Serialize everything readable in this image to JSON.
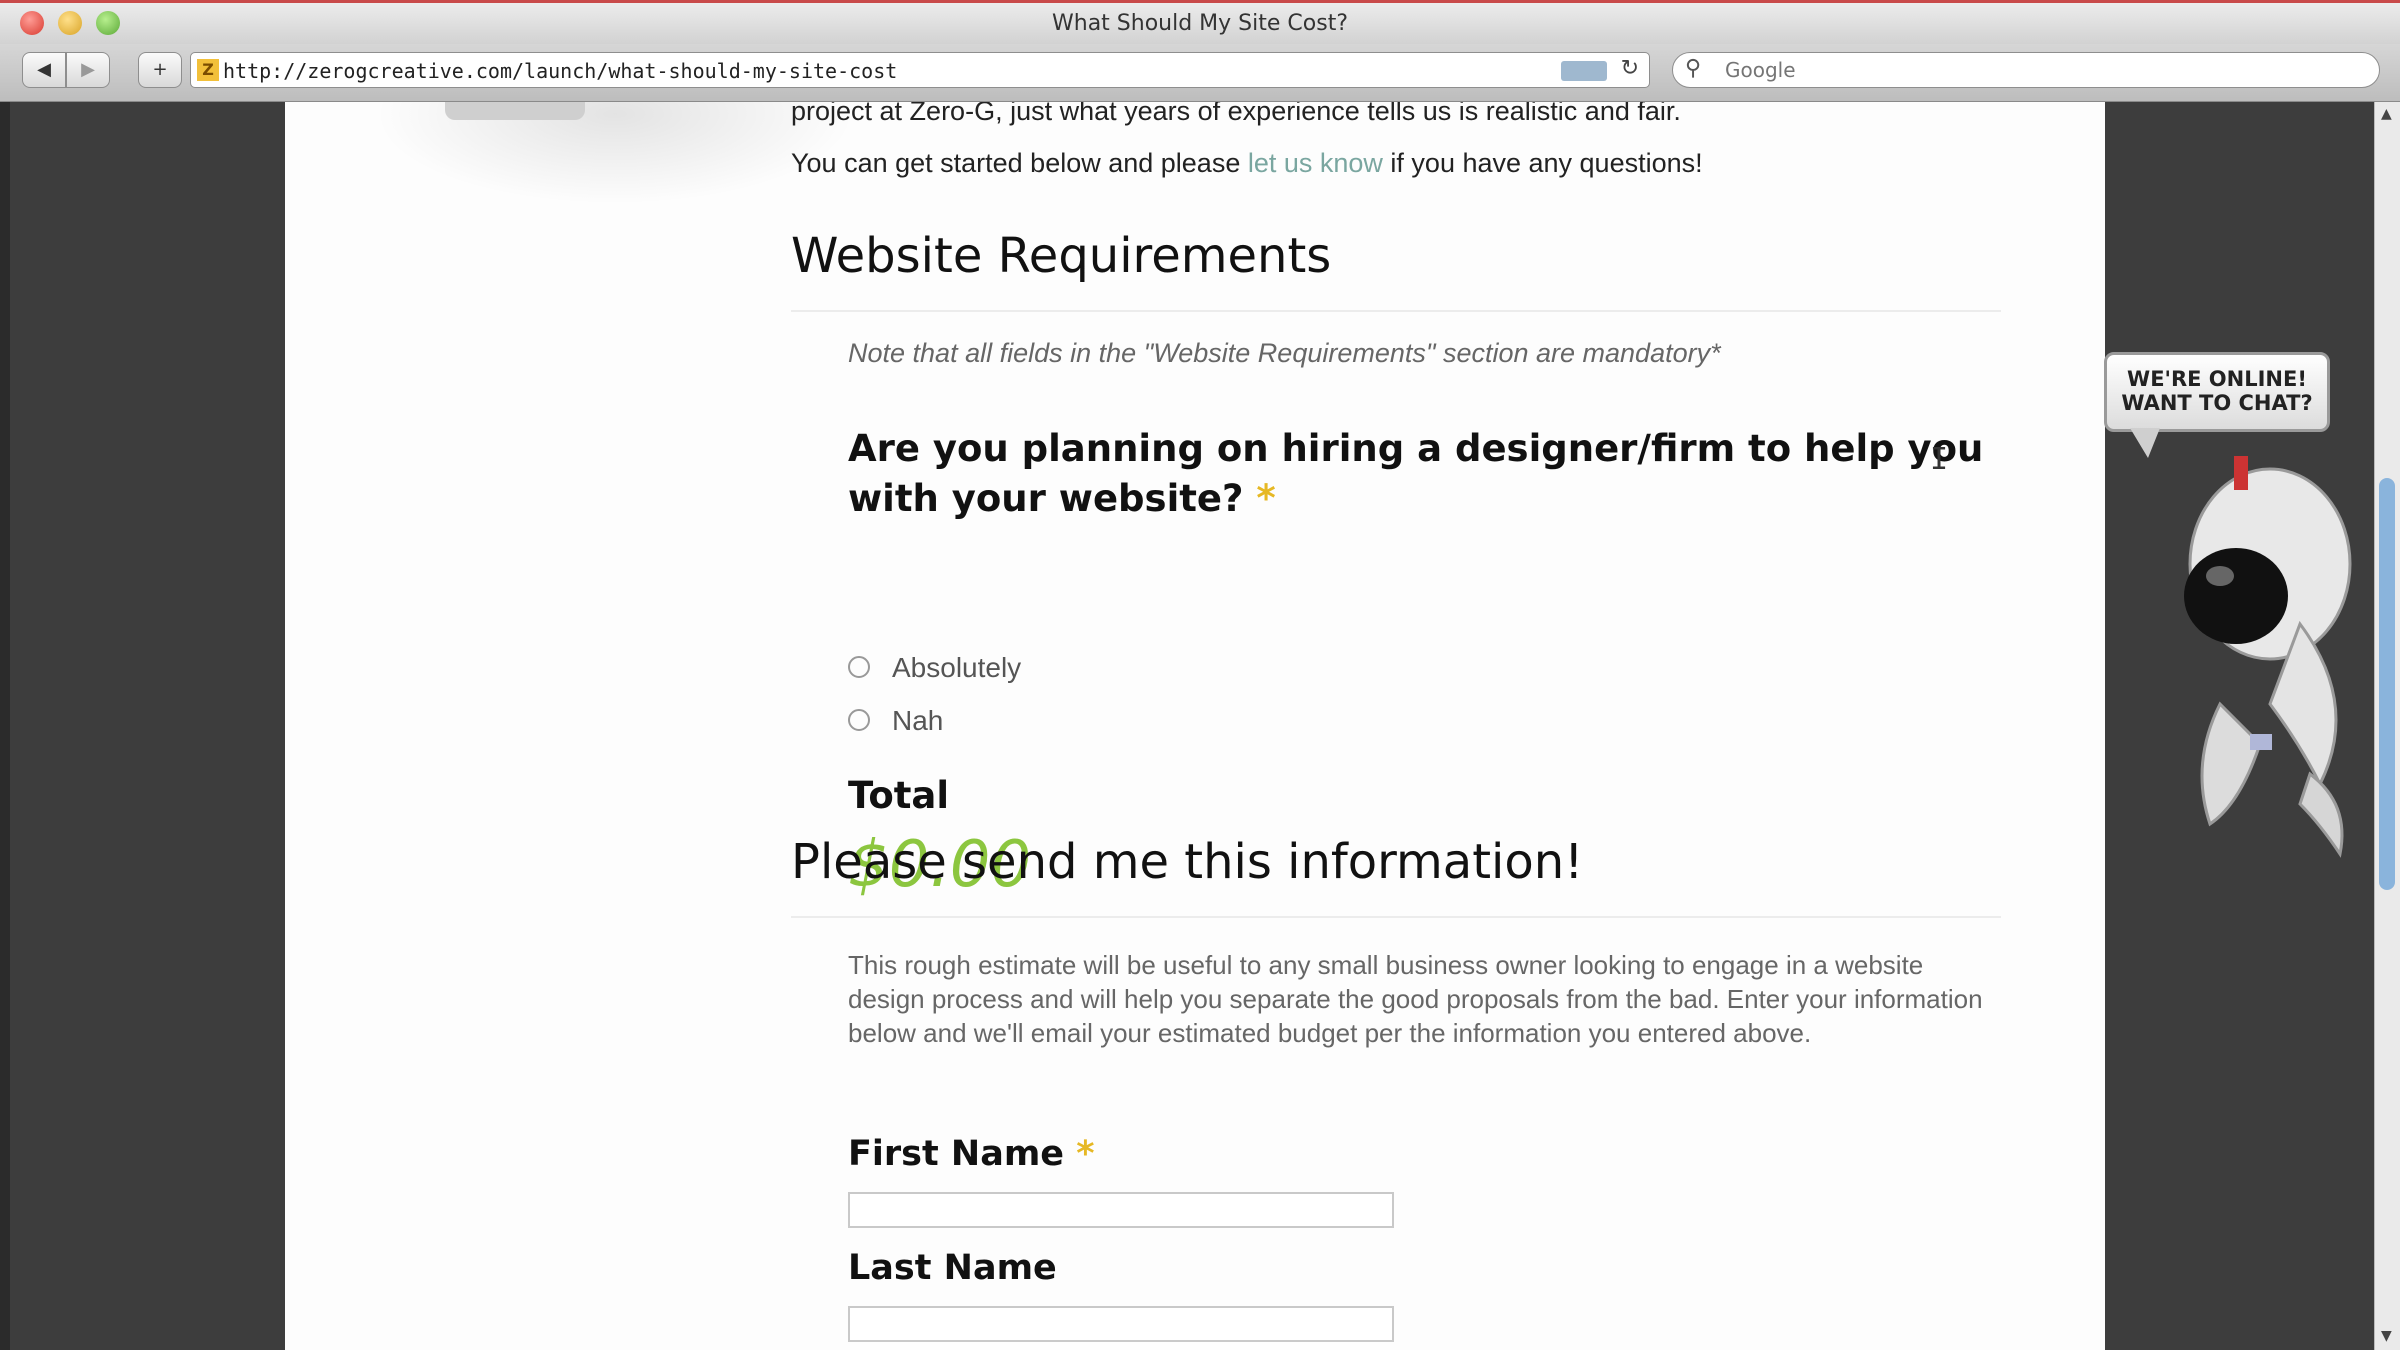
{
  "window": {
    "title": "What Should My Site Cost?"
  },
  "toolbar": {
    "back_icon": "◀",
    "forward_icon": "▶",
    "add_icon": "+",
    "url": "http://zerogcreative.com/launch/what-should-my-site-cost",
    "reload_icon": "↻",
    "search_placeholder": "Google",
    "search_icon": "⚲"
  },
  "intro": {
    "line1": "project at Zero-G, just what years of experience tells us is realistic and fair.",
    "line2_before": "You can get started below and please ",
    "line2_link": "let us know",
    "line2_after": " if you have any questions!"
  },
  "requirements": {
    "heading": "Website Requirements",
    "note": "Note that all fields in the \"Website Requirements\" section are mandatory*",
    "question": "Are you planning on hiring a designer/firm to help you with your website?",
    "required_star": "*",
    "options": [
      "Absolutely",
      "Nah"
    ],
    "total_label": "Total",
    "total_value": "$0.00"
  },
  "send_info": {
    "heading": "Please send me this information!",
    "description": "This rough estimate will be useful to any small business owner looking to engage in a website design process and will help you separate the good proposals from the bad. Enter your information below and we'll email your estimated budget per the information you entered above.",
    "first_name_label": "First Name",
    "last_name_label": "Last Name",
    "required_star": "*"
  },
  "chat": {
    "line1": "WE'RE ONLINE!",
    "line2": "WANT TO CHAT?"
  },
  "colors": {
    "accent_green": "#8cc63f",
    "required_star": "#e6b824",
    "link": "#7aa6a0"
  }
}
